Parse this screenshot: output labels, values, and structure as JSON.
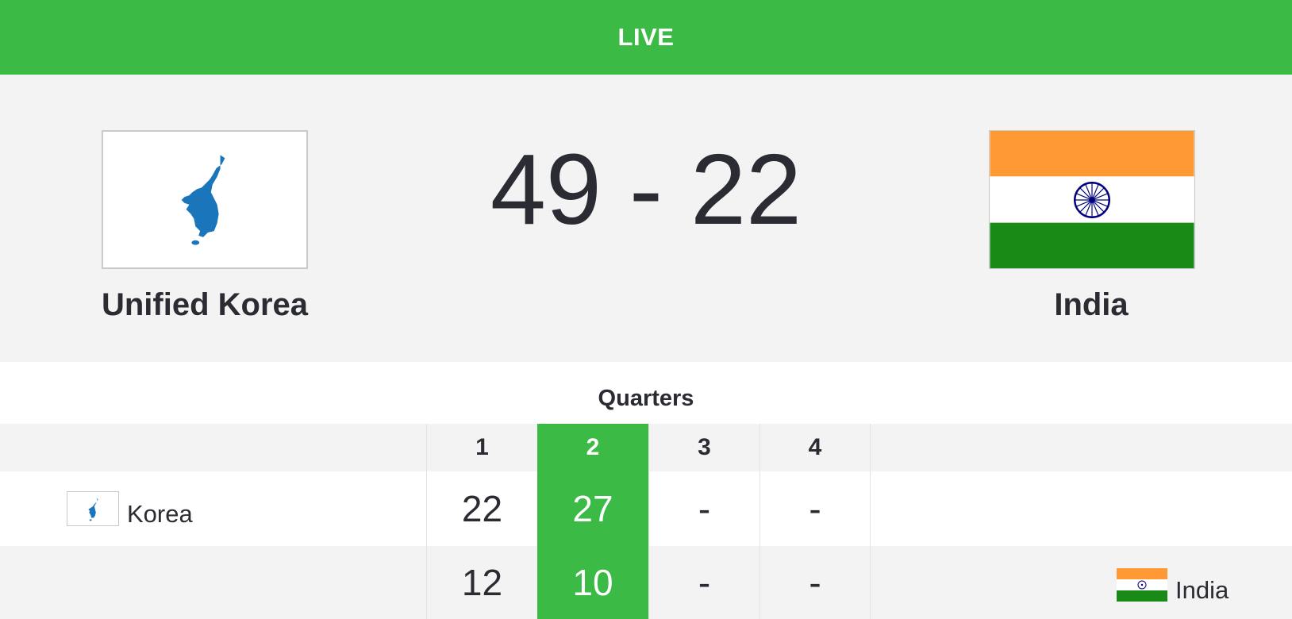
{
  "status": {
    "label": "LIVE"
  },
  "match": {
    "home": {
      "name": "Unified Korea",
      "short_name": "Korea",
      "score": "49",
      "flag_icon": "unified-korea-flag-icon"
    },
    "away": {
      "name": "India",
      "short_name": "India",
      "score": "22",
      "flag_icon": "india-flag-icon"
    },
    "score_text": "49 - 22"
  },
  "quarters": {
    "title": "Quarters",
    "headers": [
      "1",
      "2",
      "3",
      "4"
    ],
    "active_index": 1,
    "rows": [
      {
        "team": "Korea",
        "values": [
          "22",
          "27",
          "-",
          "-"
        ]
      },
      {
        "team": "India",
        "values": [
          "12",
          "10",
          "-",
          "-"
        ]
      }
    ]
  },
  "colors": {
    "accent": "#3bba45",
    "background": "#f3f3f3",
    "text": "#2b2c33",
    "korea_blue": "#1b75bb",
    "india_saffron": "#ff9933",
    "india_green": "#1a8a17",
    "india_chakra": "#000080"
  }
}
